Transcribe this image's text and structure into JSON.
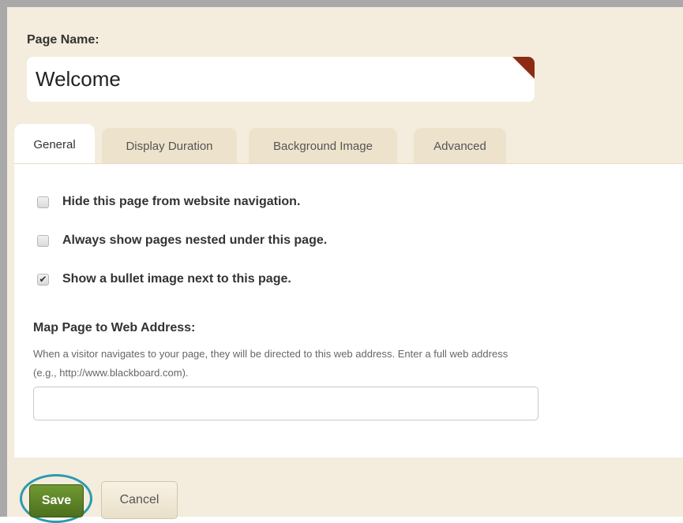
{
  "page_name": {
    "label": "Page Name:",
    "value": "Welcome"
  },
  "tabs": [
    {
      "label": "General",
      "active": true
    },
    {
      "label": "Display Duration",
      "active": false
    },
    {
      "label": "Background Image",
      "active": false
    },
    {
      "label": "Advanced",
      "active": false
    }
  ],
  "options": [
    {
      "label": "Hide this page from website navigation.",
      "checked": false
    },
    {
      "label": "Always show pages nested under this page.",
      "checked": false
    },
    {
      "label": "Show a bullet image next to this page.",
      "checked": true
    }
  ],
  "web_address": {
    "label": "Map Page to Web Address:",
    "help_line1": "When a visitor navigates to your page, they will be directed to this web address. Enter a full web address",
    "help_line2": "(e.g., http://www.blackboard.com).",
    "value": ""
  },
  "actions": {
    "save_label": "Save",
    "cancel_label": "Cancel"
  },
  "colors": {
    "panel_background": "#f4ecdc",
    "save_green": "#5a7f24",
    "highlight_ring": "#2a9bb0",
    "corner_flag": "#8b2b14"
  },
  "icons": {
    "checkmark": "check-icon",
    "corner": "corner-flag-icon"
  }
}
